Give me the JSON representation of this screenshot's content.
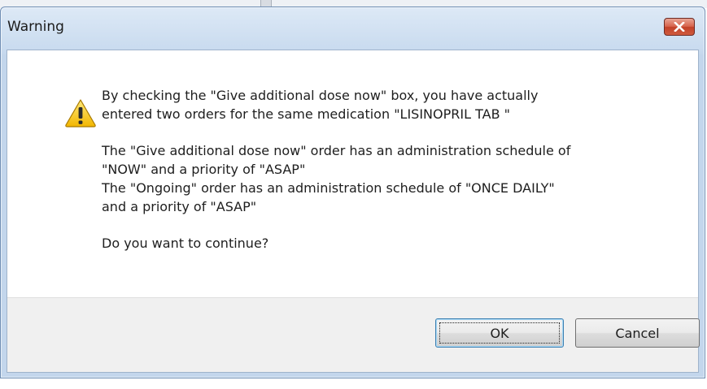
{
  "dialog": {
    "title": "Warning",
    "close_icon": "close-x-icon",
    "warning_icon": "warning-triangle-icon",
    "message": {
      "line1": "By checking the \"Give additional dose now\" box, you have actually",
      "line2": "entered two orders for the same medication \"LISINOPRIL TAB \"",
      "line3": "The \"Give additional dose now\" order has an administration schedule of",
      "line4": "\"NOW\" and a priority of \"ASAP\"",
      "line5": "The \"Ongoing\" order has an administration schedule of \"ONCE DAILY\"",
      "line6": "and a priority of \"ASAP\"",
      "line7": "Do you want to continue?"
    },
    "buttons": {
      "ok_label": "OK",
      "cancel_label": "Cancel"
    }
  },
  "colors": {
    "titlebar": "#c9dbef",
    "close_button": "#c24128",
    "warning_yellow": "#f2c200",
    "footer": "#f0f0f0"
  }
}
